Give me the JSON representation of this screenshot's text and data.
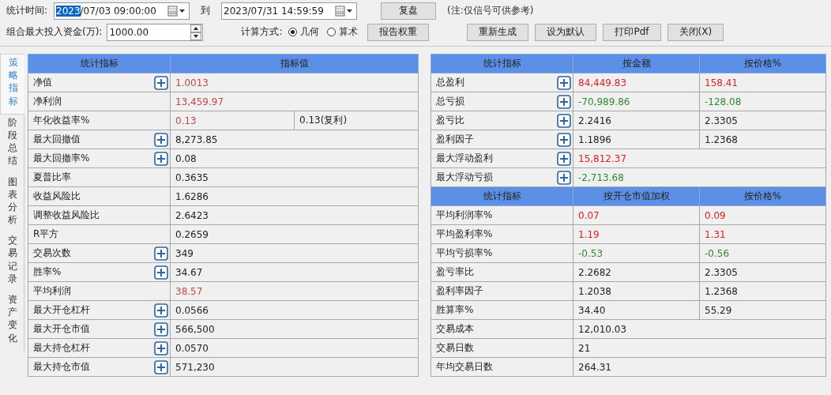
{
  "toolbar": {
    "period_label": "统计时间:",
    "start_field": {
      "selected": "2023",
      "rest": "/07/03 09:00:00"
    },
    "to_label": "到",
    "end_field": {
      "value": "2023/07/31 14:59:59"
    },
    "replay_button": "复盘",
    "note": "(注:仅信号可供参考)",
    "capital_label": "组合最大投入资金(万):",
    "capital_field": {
      "value": "1000.00"
    },
    "method_label": "计算方式:",
    "methods": [
      {
        "label": "几何",
        "selected": true
      },
      {
        "label": "算术",
        "selected": false
      }
    ],
    "buttons": [
      "报告权重",
      "重新生成",
      "设为默认",
      "打印Pdf",
      "关闭(X)"
    ]
  },
  "side_tabs": [
    {
      "label": "策略指标",
      "selected": true
    },
    {
      "label": "阶段总结",
      "selected": false
    },
    {
      "label": "图表分析",
      "selected": false
    },
    {
      "label": "交易记录",
      "selected": false
    },
    {
      "label": "资产变化",
      "selected": false
    }
  ],
  "left_table": {
    "columns": [
      "统计指标",
      "指标值"
    ],
    "rows": [
      {
        "name": "净值",
        "expandable": true,
        "values": [
          {
            "text": "1.0013",
            "color": "#c04848"
          }
        ]
      },
      {
        "name": "净利润",
        "expandable": false,
        "values": [
          {
            "text": "13,459.97",
            "color": "#c04848"
          }
        ]
      },
      {
        "name": "年化收益率%",
        "expandable": false,
        "values": [
          {
            "text": "0.13",
            "color": "#c04848"
          },
          {
            "text": "0.13(复利)"
          }
        ]
      },
      {
        "name": "最大回撤值",
        "expandable": true,
        "values": [
          {
            "text": "8,273.85"
          }
        ]
      },
      {
        "name": "最大回撤率%",
        "expandable": true,
        "values": [
          {
            "text": "0.08"
          }
        ]
      },
      {
        "name": "夏普比率",
        "expandable": false,
        "values": [
          {
            "text": "0.3635"
          }
        ]
      },
      {
        "name": "收益风险比",
        "expandable": false,
        "values": [
          {
            "text": "1.6286"
          }
        ]
      },
      {
        "name": "调整收益风险比",
        "expandable": false,
        "values": [
          {
            "text": "2.6423"
          }
        ]
      },
      {
        "name": "R平方",
        "expandable": false,
        "values": [
          {
            "text": "0.2659"
          }
        ]
      },
      {
        "name": "交易次数",
        "expandable": true,
        "values": [
          {
            "text": "349"
          }
        ]
      },
      {
        "name": "胜率%",
        "expandable": true,
        "values": [
          {
            "text": "34.67"
          }
        ]
      },
      {
        "name": "平均利润",
        "expandable": false,
        "values": [
          {
            "text": "38.57",
            "color": "#c04848"
          }
        ]
      },
      {
        "name": "最大开仓杠杆",
        "expandable": true,
        "values": [
          {
            "text": "0.0566"
          }
        ]
      },
      {
        "name": "最大开仓市值",
        "expandable": true,
        "values": [
          {
            "text": "566,500"
          }
        ]
      },
      {
        "name": "最大持仓杠杆",
        "expandable": true,
        "values": [
          {
            "text": "0.0570"
          }
        ]
      },
      {
        "name": "最大持仓市值",
        "expandable": true,
        "values": [
          {
            "text": "571,230"
          }
        ]
      }
    ]
  },
  "right_tables": [
    {
      "columns": [
        "统计指标",
        "按金额",
        "按价格%"
      ],
      "rows": [
        {
          "name": "总盈利",
          "expandable": true,
          "values": [
            {
              "text": "84,449.83",
              "color": "#e02020"
            },
            {
              "text": "158.41",
              "color": "#e02020"
            }
          ]
        },
        {
          "name": "总亏损",
          "expandable": true,
          "values": [
            {
              "text": "-70,989.86",
              "color": "#2e8a2e"
            },
            {
              "text": "-128.08",
              "color": "#2e8a2e"
            }
          ]
        },
        {
          "name": "盈亏比",
          "expandable": true,
          "values": [
            {
              "text": "2.2416"
            },
            {
              "text": "2.3305"
            }
          ]
        },
        {
          "name": "盈利因子",
          "expandable": true,
          "values": [
            {
              "text": "1.1896"
            },
            {
              "text": "1.2368"
            }
          ]
        },
        {
          "name": "最大浮动盈利",
          "expandable": true,
          "values": [
            {
              "text": "15,812.37",
              "color": "#e02020"
            }
          ]
        },
        {
          "name": "最大浮动亏损",
          "expandable": true,
          "values": [
            {
              "text": "-2,713.68",
              "color": "#2e8a2e"
            }
          ]
        }
      ]
    },
    {
      "columns": [
        "统计指标",
        "按开仓市值加权",
        "按价格%"
      ],
      "rows": [
        {
          "name": "平均利润率%",
          "expandable": false,
          "values": [
            {
              "text": "0.07",
              "color": "#e02020"
            },
            {
              "text": "0.09",
              "color": "#e02020"
            }
          ]
        },
        {
          "name": "平均盈利率%",
          "expandable": false,
          "values": [
            {
              "text": "1.19",
              "color": "#e02020"
            },
            {
              "text": "1.31",
              "color": "#e02020"
            }
          ]
        },
        {
          "name": "平均亏损率%",
          "expandable": false,
          "values": [
            {
              "text": "-0.53",
              "color": "#2e8a2e"
            },
            {
              "text": "-0.56",
              "color": "#2e8a2e"
            }
          ]
        },
        {
          "name": "盈亏率比",
          "expandable": false,
          "values": [
            {
              "text": "2.2682"
            },
            {
              "text": "2.3305"
            }
          ]
        },
        {
          "name": "盈利率因子",
          "expandable": false,
          "values": [
            {
              "text": "1.2038"
            },
            {
              "text": "1.2368"
            }
          ]
        },
        {
          "name": "胜算率%",
          "expandable": false,
          "values": [
            {
              "text": "34.40"
            },
            {
              "text": "55.29"
            }
          ]
        },
        {
          "name": "交易成本",
          "expandable": false,
          "values": [
            {
              "text": "12,010.03"
            }
          ]
        },
        {
          "name": "交易日数",
          "expandable": false,
          "values": [
            {
              "text": "21"
            }
          ]
        },
        {
          "name": "年均交易日数",
          "expandable": false,
          "values": [
            {
              "text": "264.31"
            }
          ]
        }
      ]
    }
  ]
}
